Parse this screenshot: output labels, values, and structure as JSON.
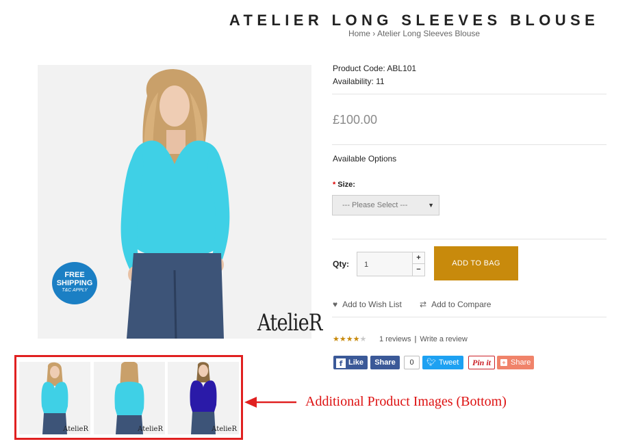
{
  "page": {
    "title": "ATELIER LONG SLEEVES BLOUSE",
    "breadcrumb": {
      "home": "Home",
      "separator": "›",
      "current": "Atelier Long Sleeves Blouse"
    }
  },
  "main_image": {
    "badge_line1": "FREE",
    "badge_line2": "SHIPPING",
    "badge_line3": "T&C APPLY",
    "brand": "AtelieR"
  },
  "thumbnails": [
    {
      "brand": "AtelieR",
      "shirt_color": "#3fd0e6"
    },
    {
      "brand": "AtelieR",
      "shirt_color": "#3fd0e6"
    },
    {
      "brand": "AtelieR",
      "shirt_color": "#2a1aa8"
    }
  ],
  "annotation": {
    "text": "Additional Product Images (Bottom)",
    "color": "#dd1010"
  },
  "product": {
    "code": "Product Code: ABL101",
    "availability": "Availability: 11",
    "price": "£100.00",
    "available_options": "Available Options",
    "size_required_mark": "*",
    "size_label": "Size:",
    "size_placeholder": "--- Please Select ---",
    "qty_label": "Qty:",
    "qty_value": "1",
    "qty_up": "+",
    "qty_down": "−",
    "add_to_bag": "ADD TO BAG",
    "wish_list": "Add to Wish List",
    "compare": "Add to Compare",
    "rating": 4,
    "rating_max": 5,
    "reviews": "1 reviews",
    "reviews_sep": "|",
    "write_review": "Write a review"
  },
  "social": {
    "fb_like": "Like",
    "fb_share": "Share",
    "fb_count": "0",
    "tweet": "Tweet",
    "pin": "Pin it",
    "gplus_share": "Share"
  },
  "colors": {
    "accent": "#c88a0c",
    "facebook": "#3b5998",
    "twitter": "#1da1f2",
    "pinterest": "#cb2027",
    "annotation_red": "#e02020"
  }
}
